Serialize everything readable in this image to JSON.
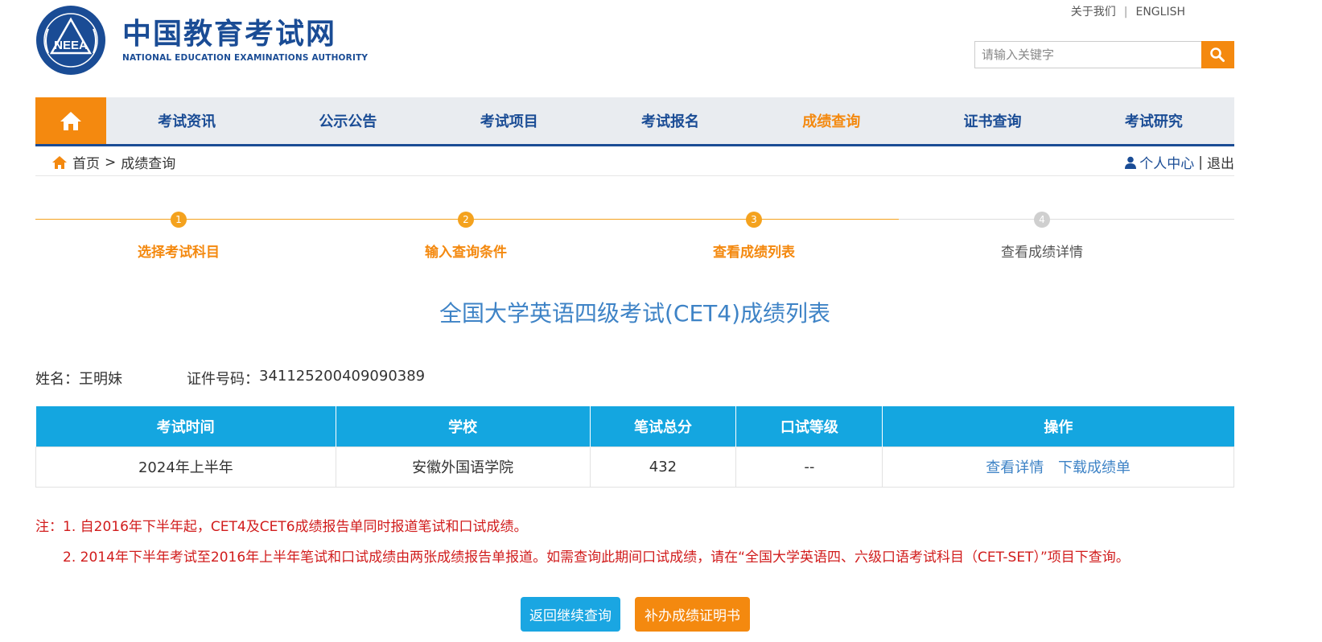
{
  "header": {
    "logo_cn": "中国教育考试网",
    "logo_en": "NATIONAL EDUCATION EXAMINATIONS AUTHORITY",
    "logo_emblem_text": "NEEA",
    "top_links": {
      "about": "关于我们",
      "separator": "|",
      "english": "ENGLISH"
    },
    "search": {
      "placeholder": "请输入关键字"
    }
  },
  "nav": {
    "items": [
      {
        "label": "考试资讯"
      },
      {
        "label": "公示公告"
      },
      {
        "label": "考试项目"
      },
      {
        "label": "考试报名"
      },
      {
        "label": "成绩查询",
        "active": true
      },
      {
        "label": "证书查询"
      },
      {
        "label": "考试研究"
      }
    ]
  },
  "breadcrumb": {
    "home": "首页",
    "sep": ">",
    "current": "成绩查询"
  },
  "user": {
    "center": "个人中心",
    "sep": "|",
    "logout": "退出"
  },
  "steps": [
    {
      "num": "1",
      "label": "选择考试科目",
      "state": "done"
    },
    {
      "num": "2",
      "label": "输入查询条件",
      "state": "done"
    },
    {
      "num": "3",
      "label": "查看成绩列表",
      "state": "done"
    },
    {
      "num": "4",
      "label": "查看成绩详情",
      "state": "todo"
    }
  ],
  "title": "全国大学英语四级考试(CET4)成绩列表",
  "info": {
    "name_label": "姓名：",
    "name": "王明妹",
    "id_label": "证件号码：",
    "id": "341125200409090389"
  },
  "table": {
    "headers": [
      "考试时间",
      "学校",
      "笔试总分",
      "口试等级",
      "操作"
    ],
    "rows": [
      {
        "time": "2024年上半年",
        "school": "安徽外国语学院",
        "score": "432",
        "oral": "--",
        "detail": "查看详情",
        "download": "下载成绩单"
      }
    ]
  },
  "notes": {
    "line1": "注：1. 自2016年下半年起，CET4及CET6成绩报告单同时报道笔试和口试成绩。",
    "line2": "2. 2014年下半年考试至2016年上半年笔试和口试成绩由两张成绩报告单报道。如需查询此期间口试成绩，请在“全国大学英语四、六级口语考试科目（CET-SET）”项目下查询。"
  },
  "buttons": {
    "back": "返回继续查询",
    "certificate": "补办成绩证明书"
  },
  "colors": {
    "brand_blue": "#1a4c95",
    "accent_orange": "#f4890f",
    "table_header": "#14a6e0",
    "note_red": "#d11c1c",
    "link_blue": "#3e83c6"
  }
}
